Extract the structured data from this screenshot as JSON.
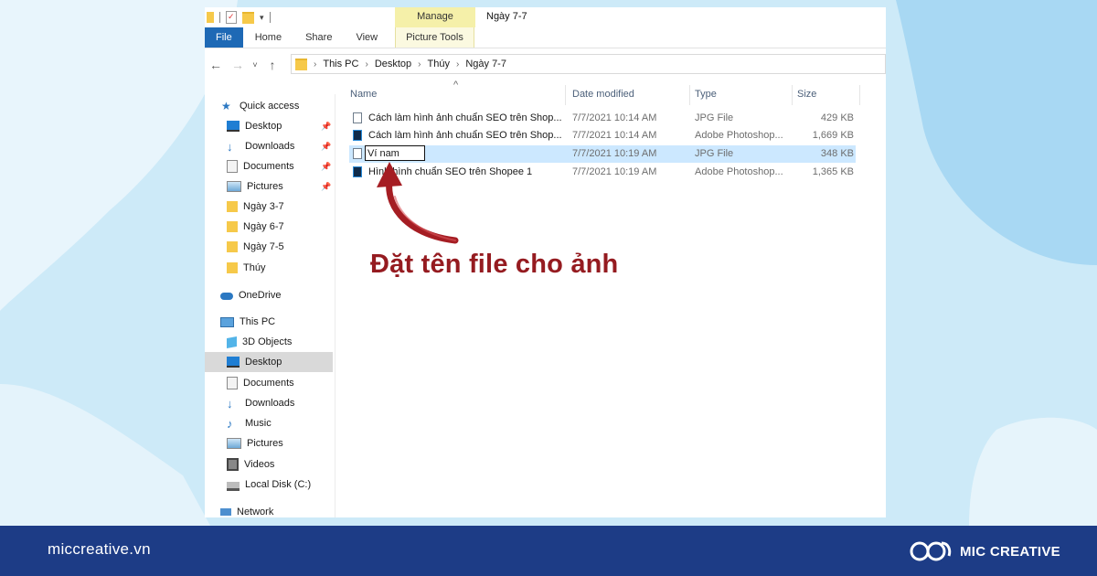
{
  "window": {
    "title": "Ngày 7-7",
    "context_tab": "Manage",
    "ribbon_tabs": [
      "File",
      "Home",
      "Share",
      "View",
      "Picture Tools"
    ]
  },
  "address": {
    "crumbs": [
      "This PC",
      "Desktop",
      "Thúy",
      "Ngày 7-7"
    ]
  },
  "nav": {
    "quick_access": "Quick access",
    "quick_items": [
      "Desktop",
      "Downloads",
      "Documents",
      "Pictures",
      "Ngày 3-7",
      "Ngày 6-7",
      "Ngày 7-5",
      "Thúy"
    ],
    "onedrive": "OneDrive",
    "this_pc": "This PC",
    "pc_items": [
      "3D Objects",
      "Desktop",
      "Documents",
      "Downloads",
      "Music",
      "Pictures",
      "Videos",
      "Local Disk (C:)"
    ],
    "network": "Network",
    "selected_pc_item": "Desktop"
  },
  "columns": [
    "Name",
    "Date modified",
    "Type",
    "Size"
  ],
  "files": [
    {
      "name": "Cách làm hình ảnh chuẩn SEO trên Shop...",
      "date": "7/7/2021 10:14 AM",
      "type": "JPG File",
      "size": "429 KB",
      "icon": "jpg-file-icon"
    },
    {
      "name": "Cách làm hình ảnh chuẩn SEO trên Shop...",
      "date": "7/7/2021 10:14 AM",
      "type": "Adobe Photoshop...",
      "size": "1,669 KB",
      "icon": "photoshop-file-icon"
    },
    {
      "name": "Ví nam",
      "date": "7/7/2021 10:19 AM",
      "type": "JPG File",
      "size": "348 KB",
      "icon": "jpg-file-icon",
      "renaming": true
    },
    {
      "name": "Hình hình chuẩn SEO trên Shopee 1",
      "date": "7/7/2021 10:19 AM",
      "type": "Adobe Photoshop...",
      "size": "1,365 KB",
      "icon": "photoshop-file-icon"
    }
  ],
  "annotation": "Đặt tên file cho ảnh",
  "footer": {
    "site": "miccreative.vn",
    "brand": "MIC CREATIVE"
  },
  "colors": {
    "footer_bg": "#1d3c86",
    "file_tab": "#1e69b5",
    "annotation": "#951b20",
    "selection": "#cce8ff"
  }
}
